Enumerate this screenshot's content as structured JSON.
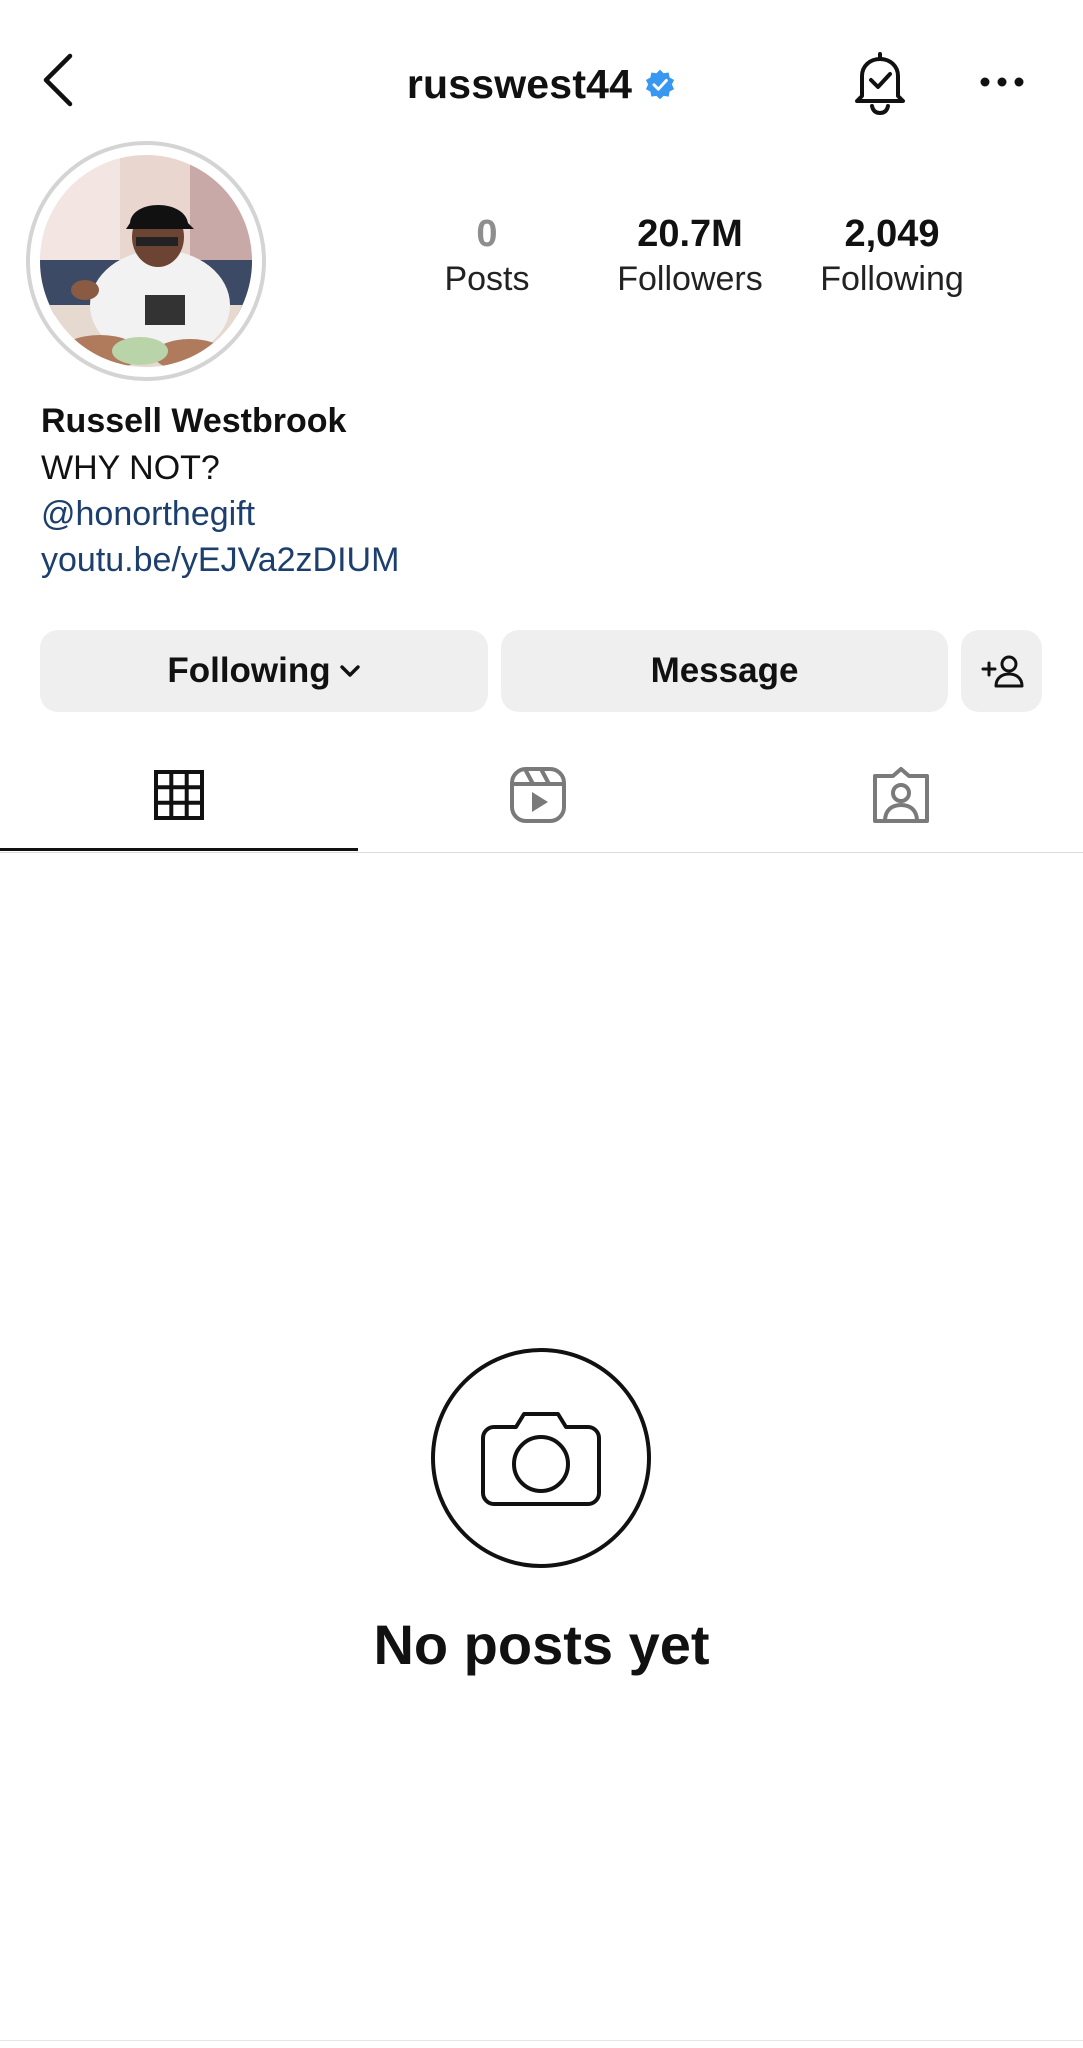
{
  "header": {
    "username": "russwest44",
    "verified": true,
    "icons": {
      "back": "chevron-left-icon",
      "verified": "verified-badge-icon",
      "notifications": "bell-check-icon",
      "more": "more-horizontal-icon"
    }
  },
  "profile": {
    "stats": [
      {
        "value": "0",
        "label": "Posts"
      },
      {
        "value": "20.7M",
        "label": "Followers"
      },
      {
        "value": "2,049",
        "label": "Following"
      }
    ],
    "name": "Russell Westbrook",
    "bio": "WHY NOT?",
    "mention": "@honorthegift",
    "link": "youtu.be/yEJVa2zDIUM"
  },
  "actions": {
    "following_label": "Following",
    "message_label": "Message",
    "add_user_icon": "add-person-icon"
  },
  "tabs": [
    {
      "icon": "grid-icon",
      "active": true
    },
    {
      "icon": "reels-icon",
      "active": false
    },
    {
      "icon": "tagged-icon",
      "active": false
    }
  ],
  "empty_state": {
    "icon": "camera-icon",
    "text": "No posts yet"
  },
  "colors": {
    "verified_blue": "#3897f0",
    "link_blue": "#1c3f6e",
    "button_bg": "#efefef",
    "divider": "#dbdbdb"
  }
}
